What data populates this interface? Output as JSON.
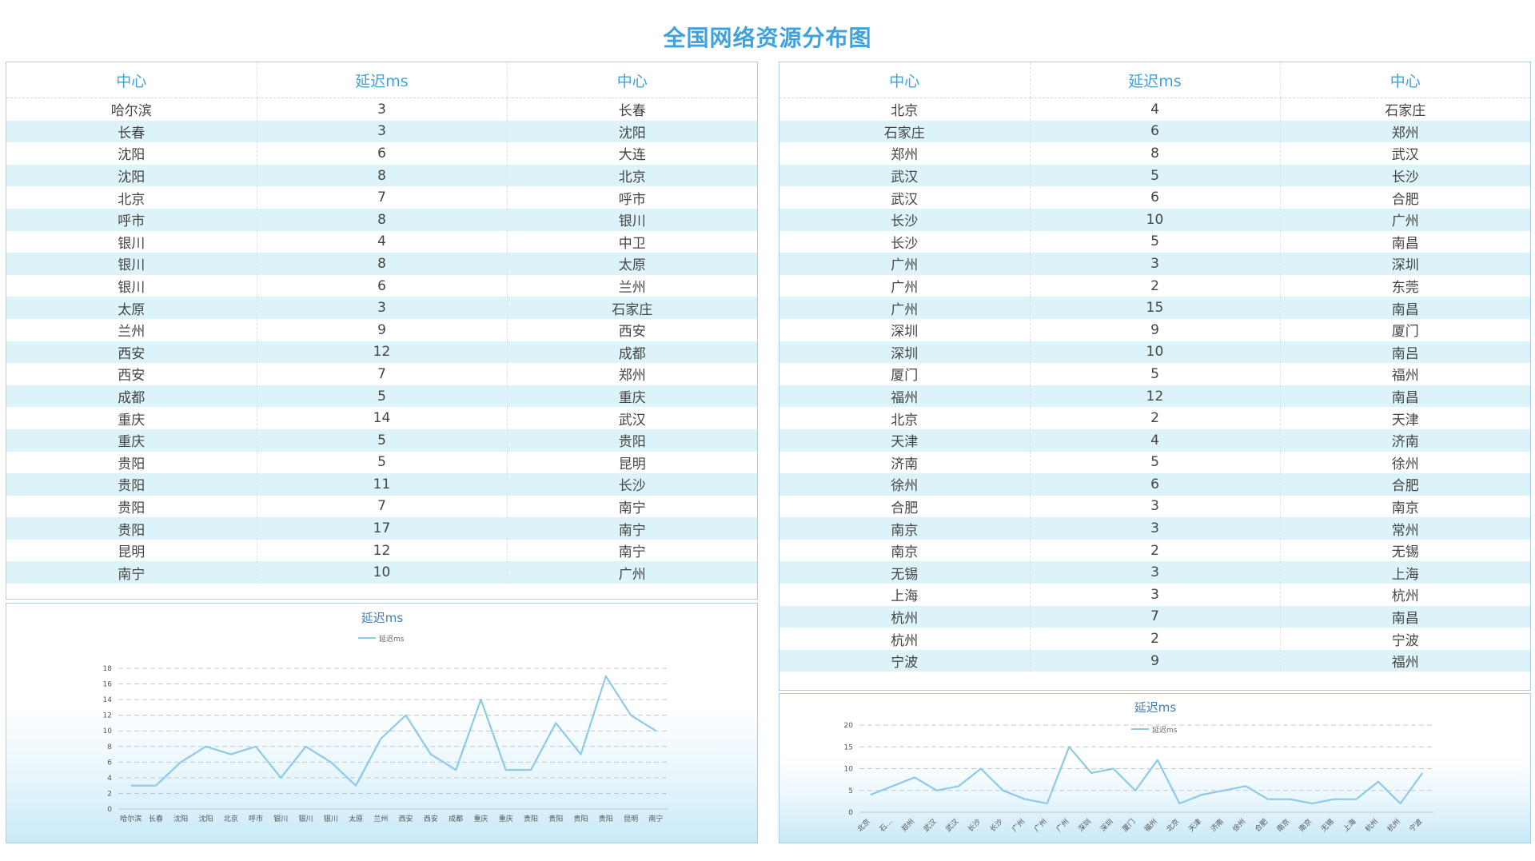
{
  "page": {
    "title": "全国网络资源分布图"
  },
  "theme": {
    "accent": "#3fa2dc",
    "line": "#8ecae8",
    "row_alt": "#dcf3f9"
  },
  "left_table": {
    "headers": [
      "中心",
      "延迟ms",
      "中心"
    ],
    "rows": [
      [
        "哈尔滨",
        "3",
        "长春"
      ],
      [
        "长春",
        "3",
        "沈阳"
      ],
      [
        "沈阳",
        "6",
        "大连"
      ],
      [
        "沈阳",
        "8",
        "北京"
      ],
      [
        "北京",
        "7",
        "呼市"
      ],
      [
        "呼市",
        "8",
        "银川"
      ],
      [
        "银川",
        "4",
        "中卫"
      ],
      [
        "银川",
        "8",
        "太原"
      ],
      [
        "银川",
        "6",
        "兰州"
      ],
      [
        "太原",
        "3",
        "石家庄"
      ],
      [
        "兰州",
        "9",
        "西安"
      ],
      [
        "西安",
        "12",
        "成都"
      ],
      [
        "西安",
        "7",
        "郑州"
      ],
      [
        "成都",
        "5",
        "重庆"
      ],
      [
        "重庆",
        "14",
        "武汉"
      ],
      [
        "重庆",
        "5",
        "贵阳"
      ],
      [
        "贵阳",
        "5",
        "昆明"
      ],
      [
        "贵阳",
        "11",
        "长沙"
      ],
      [
        "贵阳",
        "7",
        "南宁"
      ],
      [
        "贵阳",
        "17",
        "南宁"
      ],
      [
        "昆明",
        "12",
        "南宁"
      ],
      [
        "南宁",
        "10",
        "广州"
      ]
    ]
  },
  "right_table": {
    "headers": [
      "中心",
      "延迟ms",
      "中心"
    ],
    "rows": [
      [
        "北京",
        "4",
        "石家庄"
      ],
      [
        "石家庄",
        "6",
        "郑州"
      ],
      [
        "郑州",
        "8",
        "武汉"
      ],
      [
        "武汉",
        "5",
        "长沙"
      ],
      [
        "武汉",
        "6",
        "合肥"
      ],
      [
        "长沙",
        "10",
        "广州"
      ],
      [
        "长沙",
        "5",
        "南昌"
      ],
      [
        "广州",
        "3",
        "深圳"
      ],
      [
        "广州",
        "2",
        "东莞"
      ],
      [
        "广州",
        "15",
        "南昌"
      ],
      [
        "深圳",
        "9",
        "厦门"
      ],
      [
        "深圳",
        "10",
        "南吕"
      ],
      [
        "厦门",
        "5",
        "福州"
      ],
      [
        "福州",
        "12",
        "南昌"
      ],
      [
        "北京",
        "2",
        "天津"
      ],
      [
        "天津",
        "4",
        "济南"
      ],
      [
        "济南",
        "5",
        "徐州"
      ],
      [
        "徐州",
        "6",
        "合肥"
      ],
      [
        "合肥",
        "3",
        "南京"
      ],
      [
        "南京",
        "3",
        "常州"
      ],
      [
        "南京",
        "2",
        "无锡"
      ],
      [
        "无锡",
        "3",
        "上海"
      ],
      [
        "上海",
        "3",
        "杭州"
      ],
      [
        "杭州",
        "7",
        "南昌"
      ],
      [
        "杭州",
        "2",
        "宁波"
      ],
      [
        "宁波",
        "9",
        "福州"
      ]
    ]
  },
  "chart_data": [
    {
      "type": "line",
      "title": "延迟ms",
      "legend": "top-center",
      "grid": true,
      "ylim": [
        0,
        18
      ],
      "yticks": [
        0,
        2,
        4,
        6,
        8,
        10,
        12,
        14,
        16,
        18
      ],
      "categories": [
        "哈尔滨",
        "长春",
        "沈阳",
        "沈阳",
        "北京",
        "呼市",
        "银川",
        "银川",
        "银川",
        "太原",
        "兰州",
        "西安",
        "西安",
        "成都",
        "重庆",
        "重庆",
        "贵阳",
        "贵阳",
        "贵阳",
        "贵阳",
        "昆明",
        "南宁"
      ],
      "series": [
        {
          "name": "延迟ms",
          "values": [
            3,
            3,
            6,
            8,
            7,
            8,
            4,
            8,
            6,
            3,
            9,
            12,
            7,
            5,
            14,
            5,
            5,
            11,
            7,
            17,
            12,
            10
          ]
        }
      ]
    },
    {
      "type": "line",
      "title": "延迟ms",
      "legend": "top-center",
      "grid": true,
      "ylim": [
        0,
        20
      ],
      "yticks": [
        0,
        5,
        10,
        15,
        20
      ],
      "categories": [
        "北京",
        "石…",
        "郑州",
        "武汉",
        "武汉",
        "长沙",
        "长沙",
        "广州",
        "广州",
        "广州",
        "深圳",
        "深圳",
        "厦门",
        "福州",
        "北京",
        "天津",
        "济南",
        "徐州",
        "合肥",
        "南京",
        "南京",
        "无锡",
        "上海",
        "杭州",
        "杭州",
        "宁波"
      ],
      "series": [
        {
          "name": "延迟ms",
          "values": [
            4,
            6,
            8,
            5,
            6,
            10,
            5,
            3,
            2,
            15,
            9,
            10,
            5,
            12,
            2,
            4,
            5,
            6,
            3,
            3,
            2,
            3,
            3,
            7,
            2,
            9
          ]
        }
      ]
    }
  ]
}
